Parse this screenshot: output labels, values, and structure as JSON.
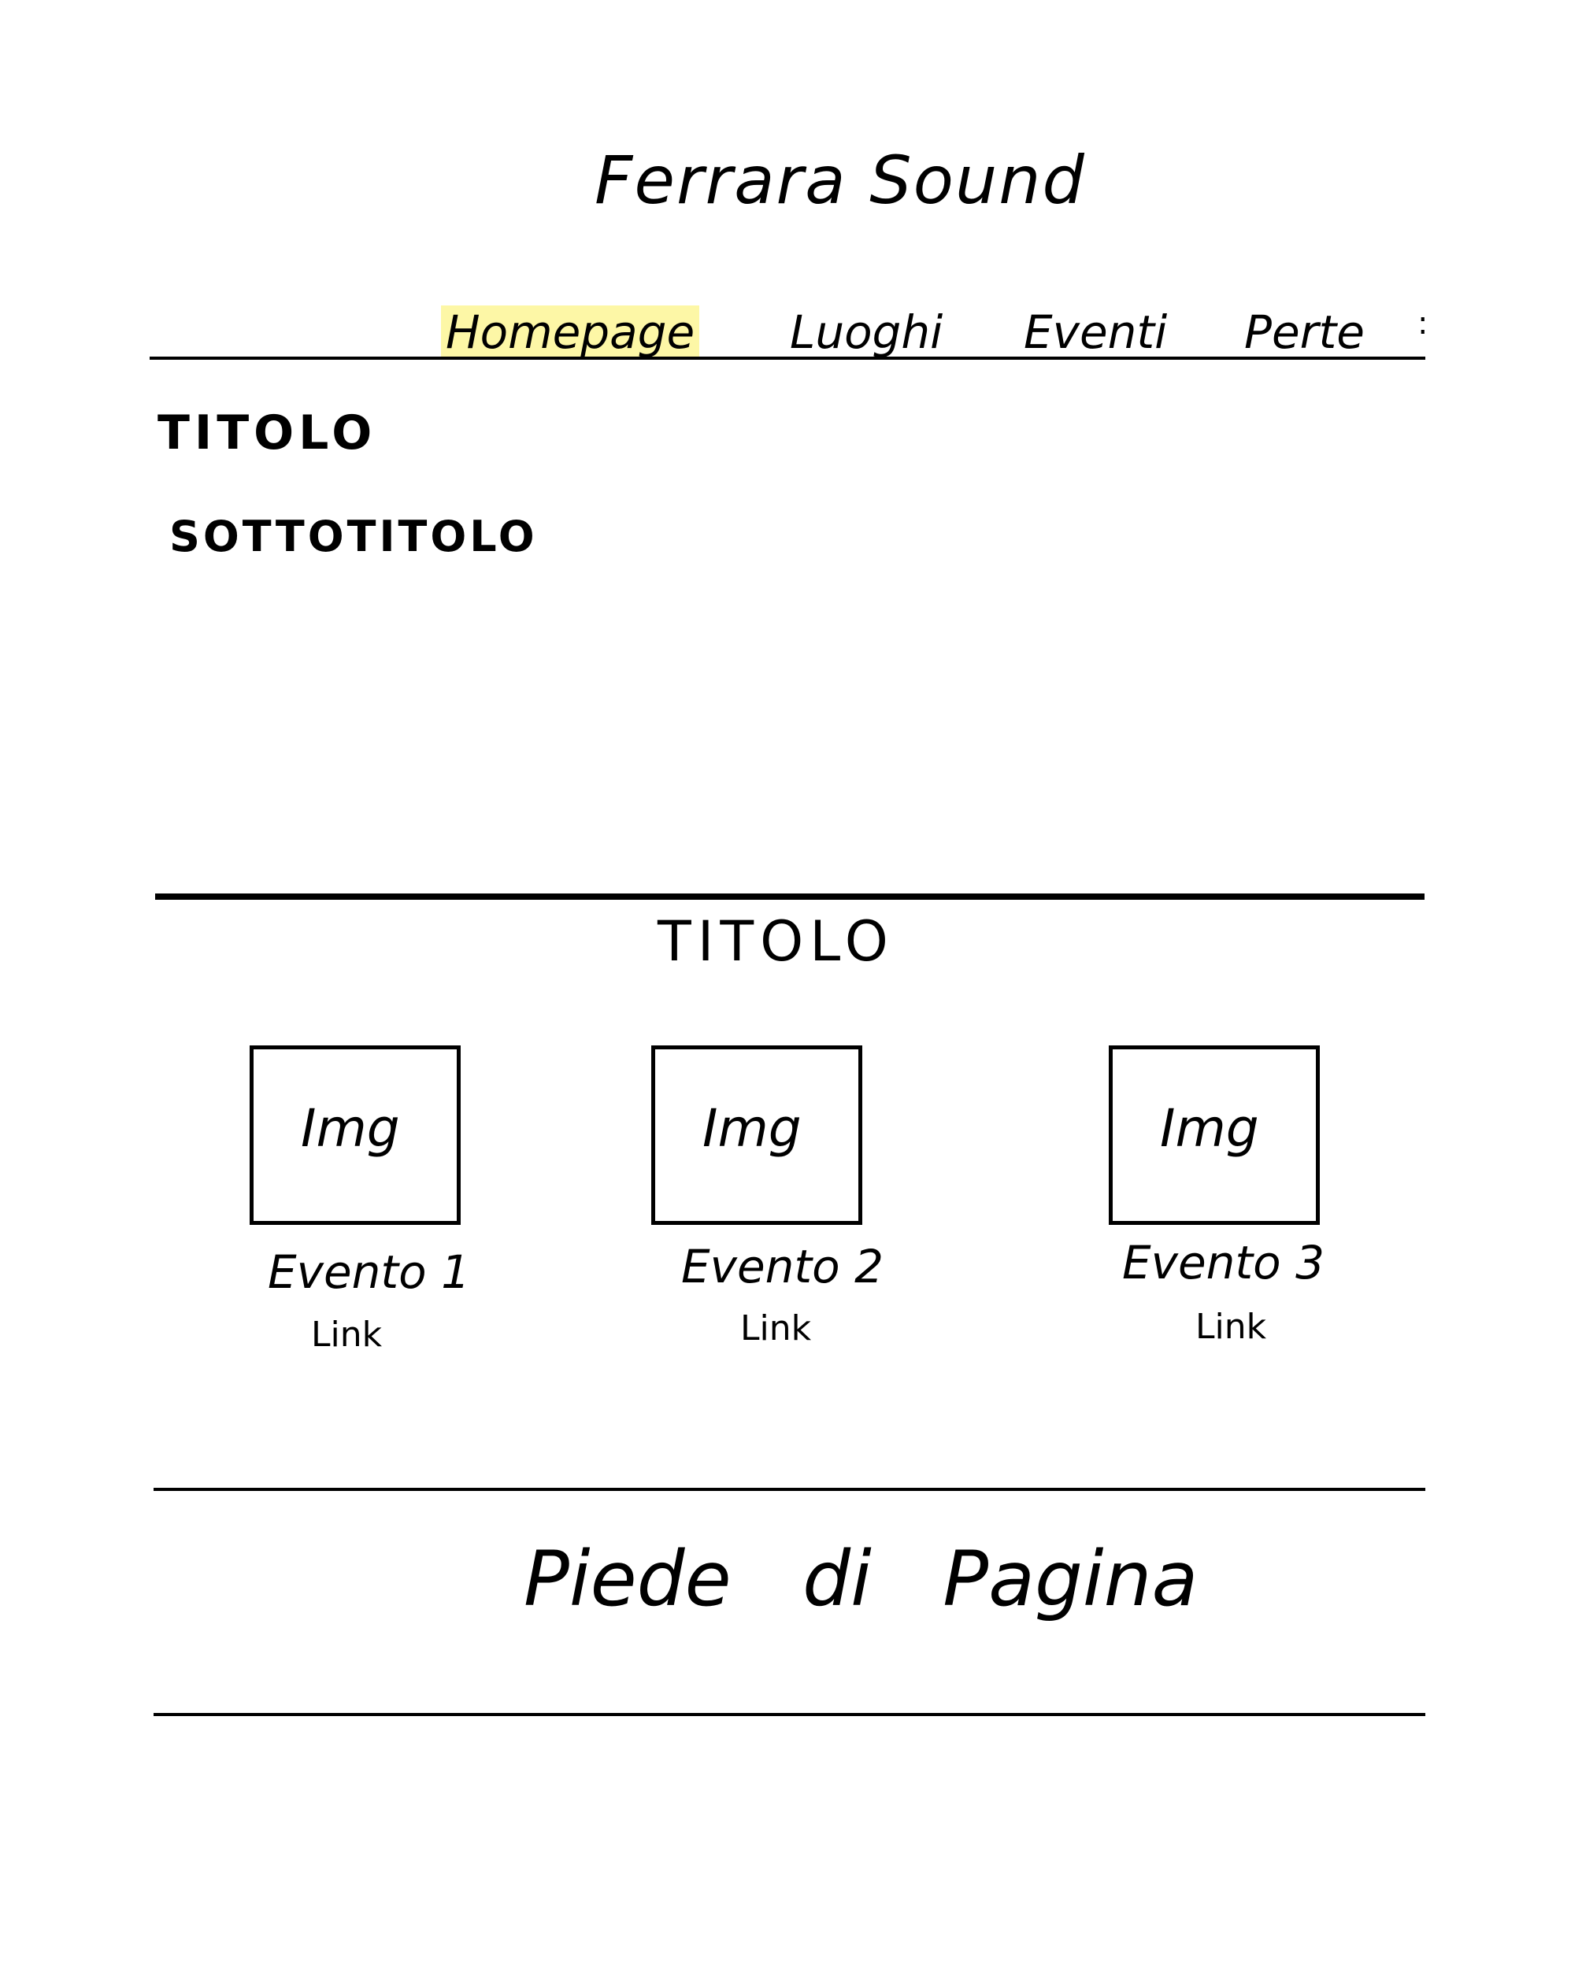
{
  "header": {
    "site_title": "Ferrara Sound"
  },
  "nav": {
    "items": [
      {
        "label": "Homepage",
        "highlighted": true
      },
      {
        "label": "Luoghi"
      },
      {
        "label": "Eventi"
      },
      {
        "label": "Perte"
      }
    ],
    "more": ":"
  },
  "hero": {
    "title": "TITOLO",
    "subtitle": "SOTTOTITOLO"
  },
  "events_section": {
    "title": "TITOLO",
    "cards": [
      {
        "image_label": "Img",
        "name": "Evento 1",
        "link": "Link"
      },
      {
        "image_label": "Img",
        "name": "Evento 2",
        "link": "Link"
      },
      {
        "image_label": "Img",
        "name": "Evento 3",
        "link": "Link"
      }
    ]
  },
  "footer": {
    "text": "Piede di Pagina"
  },
  "colors": {
    "ink": "#000000",
    "highlight": "#fdf7a6",
    "paper": "#ffffff"
  }
}
